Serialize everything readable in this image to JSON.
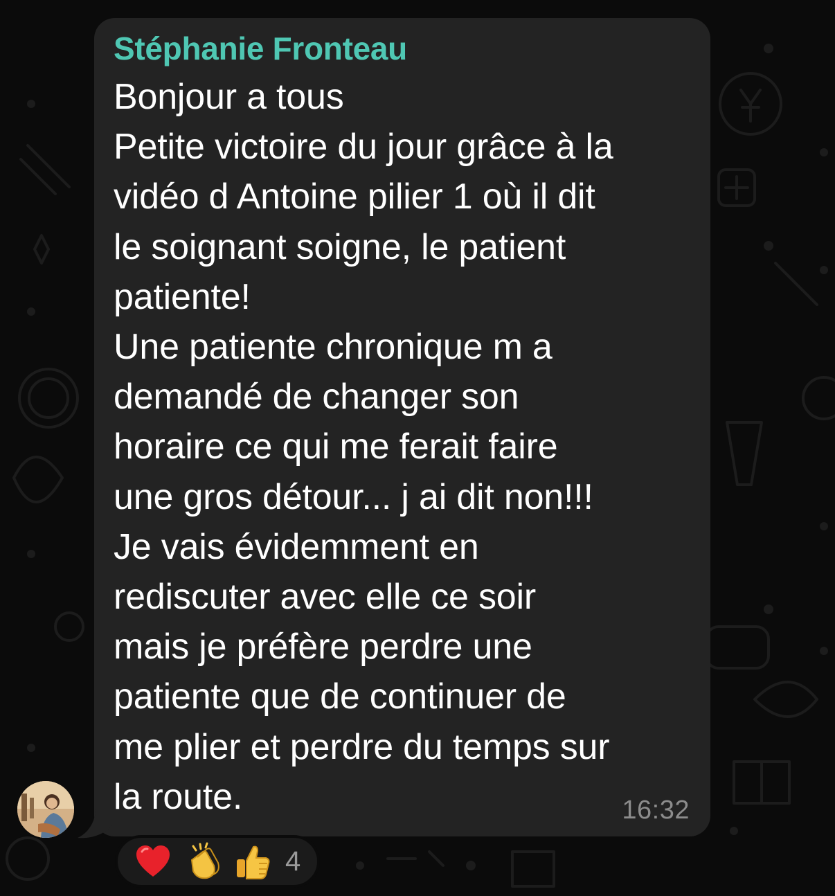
{
  "message": {
    "sender": "Stéphanie Fronteau",
    "lines": [
      "Bonjour a tous",
      "Petite victoire du jour grâce à la",
      "vidéo d Antoine pilier 1 où il dit",
      "le soignant soigne, le patient",
      "patiente!",
      "Une patiente chronique m a",
      "demandé de changer son",
      "horaire ce qui me ferait faire",
      "une gros détour... j ai dit non!!!",
      "Je vais évidemment en",
      "rediscuter avec elle ce soir",
      "mais je préfère perdre une",
      "patiente que de continuer de",
      "me plier et perdre du temps sur",
      "la route."
    ],
    "time": "16:32"
  },
  "reactions": {
    "items": [
      {
        "emoji": "❤️",
        "icon": "red-heart-icon"
      },
      {
        "emoji": "👏",
        "icon": "clapping-hands-icon"
      },
      {
        "emoji": "👍",
        "icon": "thumbs-up-icon"
      }
    ],
    "count": "4"
  },
  "colors": {
    "sender_name": "#4fc7b3",
    "bubble": "#232323",
    "background": "#0b0b0b",
    "timestamp": "#8c8c8c"
  }
}
